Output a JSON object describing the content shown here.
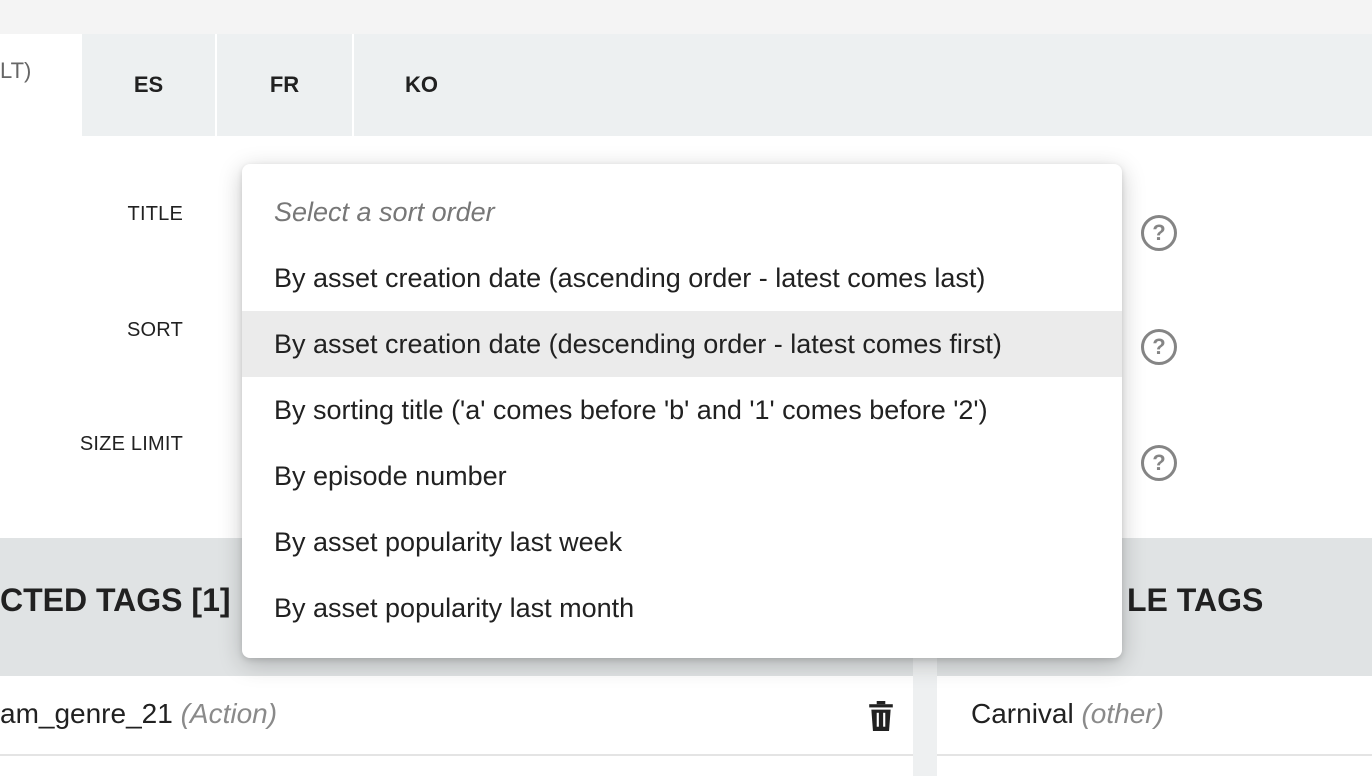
{
  "tabs": {
    "active_partial_label": "LT)",
    "items": [
      {
        "label": "ES"
      },
      {
        "label": "FR"
      },
      {
        "label": "KO"
      }
    ]
  },
  "form": {
    "title_label": "TITLE",
    "sort_label": "SORT",
    "size_limit_label": "SIZE LIMIT",
    "help_glyph": "?"
  },
  "sort_dropdown": {
    "placeholder": "Select a sort order",
    "options": [
      {
        "label": "By asset creation date (ascending order - latest comes last)"
      },
      {
        "label": "By asset creation date (descending order - latest comes first)",
        "highlighted": true
      },
      {
        "label": "By sorting title ('a' comes before 'b' and '1' comes before '2')"
      },
      {
        "label": "By episode number"
      },
      {
        "label": "By asset popularity last week"
      },
      {
        "label": "By asset popularity last month"
      }
    ]
  },
  "selected_tags": {
    "header": "CTED TAGS [1]",
    "rows": [
      {
        "name": "am_genre_21",
        "category": "(Action)"
      }
    ]
  },
  "available_tags": {
    "header": "LE TAGS",
    "rows": [
      {
        "name": "Carnival",
        "category": "(other)"
      }
    ]
  },
  "icons": {
    "help": "help-circle-icon",
    "delete": "trash-icon"
  },
  "colors": {
    "tabbar_bg": "#edf0f1",
    "header_bg": "#e0e3e4",
    "highlight_bg": "#ebebeb",
    "muted_text": "#8a8a8a"
  }
}
